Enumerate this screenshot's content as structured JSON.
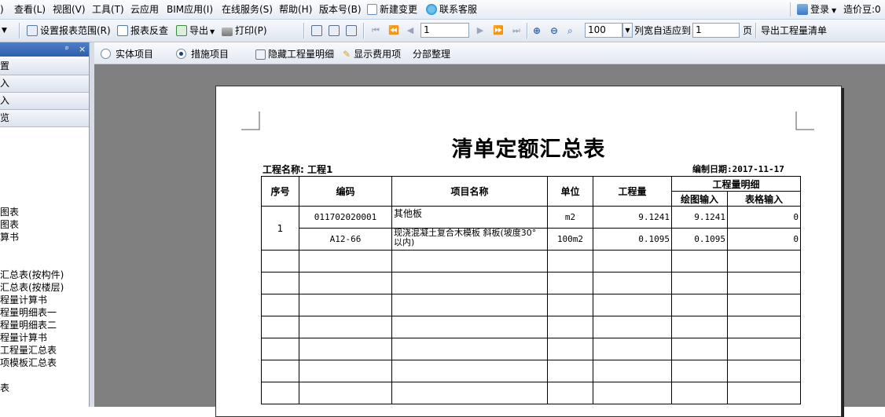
{
  "menu": {
    "items": [
      "查看(L)",
      "视图(V)",
      "工具(T)",
      "云应用",
      "BIM应用(I)",
      "在线服务(S)",
      "帮助(H)",
      "版本号(B)"
    ],
    "new_change": "新建变更",
    "support": "联系客服",
    "login": "登录",
    "credits": "造价豆:0"
  },
  "toolbar": {
    "set_range": "设置报表范围(R)",
    "check": "报表反查",
    "export": "导出",
    "print": "打印(P)",
    "page_num": "1",
    "zoom": "100",
    "fit_label": "列宽自适应到",
    "fit_value": "1",
    "page_suffix": "页",
    "export_list": "导出工程量清单"
  },
  "left_panel": {
    "tabs": [
      "置",
      "入",
      "入",
      "览"
    ],
    "items": [
      "图表",
      "图表",
      "算书",
      "汇总表(按构件)",
      "汇总表(按楼层)",
      "程量计算书",
      "程量明细表一",
      "程量明细表二",
      "程量计算书",
      "工程量汇总表",
      "项模板汇总表",
      "表"
    ]
  },
  "options": {
    "radio_entity": "实体项目",
    "radio_measure": "措施项目",
    "hide_detail": "隐藏工程量明细",
    "show_fee": "显示费用项",
    "section_sort": "分部整理"
  },
  "report": {
    "title": "清单定额汇总表",
    "project_label": "工程名称: 工程1",
    "date_label": "编制日期:2017-11-17",
    "headers": {
      "seq": "序号",
      "code": "编码",
      "name": "项目名称",
      "unit": "单位",
      "qty": "工程量",
      "detail": "工程量明细",
      "drawing": "绘图输入",
      "table": "表格输入"
    },
    "rows": [
      {
        "seq": "1",
        "code": "011702020001",
        "name": "其他板",
        "unit": "m2",
        "qty": "9.1241",
        "drawing": "9.1241",
        "table": "0"
      },
      {
        "seq": "",
        "code": "A12-66",
        "name": "现浇混凝土复合木模板 斜板(坡度30° 以内)",
        "unit": "100m2",
        "qty": "0.1095",
        "drawing": "0.1095",
        "table": "0"
      }
    ]
  }
}
